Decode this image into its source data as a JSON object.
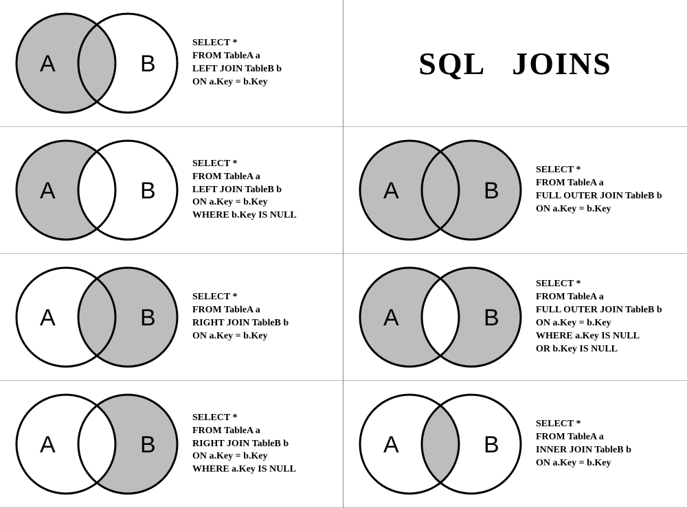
{
  "title": "SQL   JOINS",
  "labels": {
    "a": "A",
    "b": "B"
  },
  "shade": "#bdbdbd",
  "joins": [
    {
      "id": "left-join",
      "fill": {
        "left": true,
        "right": false,
        "center": true
      },
      "sql": "SELECT *\nFROM TableA a\nLEFT JOIN TableB b\nON a.Key = b.Key"
    },
    {
      "id": "left-excl",
      "fill": {
        "left": true,
        "right": false,
        "center": false
      },
      "sql": "SELECT *\nFROM TableA a\nLEFT JOIN TableB b\nON a.Key = b.Key\nWHERE b.Key IS NULL"
    },
    {
      "id": "full-outer",
      "fill": {
        "left": true,
        "right": true,
        "center": true
      },
      "sql": "SELECT *\nFROM TableA a\nFULL OUTER JOIN TableB b\nON a.Key = b.Key"
    },
    {
      "id": "right-join",
      "fill": {
        "left": false,
        "right": true,
        "center": true
      },
      "sql": "SELECT *\nFROM TableA a\nRIGHT JOIN TableB b\nON a.Key = b.Key"
    },
    {
      "id": "full-outer-excl",
      "fill": {
        "left": true,
        "right": true,
        "center": false
      },
      "sql": "SELECT *\nFROM TableA a\nFULL OUTER JOIN TableB b\nON a.Key = b.Key\nWHERE a.Key IS NULL\nOR b.Key IS NULL"
    },
    {
      "id": "right-excl",
      "fill": {
        "left": false,
        "right": true,
        "center": false
      },
      "sql": "SELECT *\nFROM TableA a\nRIGHT JOIN TableB b\nON a.Key = b.Key\nWHERE a.Key IS NULL"
    },
    {
      "id": "inner-join",
      "fill": {
        "left": false,
        "right": false,
        "center": true
      },
      "sql": "SELECT *\nFROM TableA a\nINNER JOIN TableB b\nON a.Key = b.Key"
    }
  ]
}
